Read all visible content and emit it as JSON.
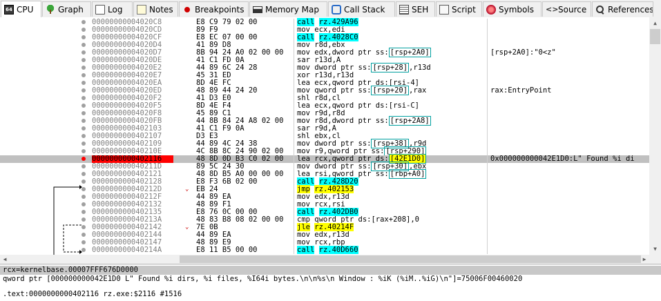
{
  "tabs": [
    {
      "label": "CPU",
      "icon": "cpu-icon"
    },
    {
      "label": "Graph",
      "icon": "tree-icon"
    },
    {
      "label": "Log",
      "icon": "log-icon"
    },
    {
      "label": "Notes",
      "icon": "notes-icon"
    },
    {
      "label": "Breakpoints",
      "icon": "breakpoint-icon"
    },
    {
      "label": "Memory Map",
      "icon": "memory-icon"
    },
    {
      "label": "Call Stack",
      "icon": "call-stack-icon"
    },
    {
      "label": "SEH",
      "icon": "seh-icon"
    },
    {
      "label": "Script",
      "icon": "script-icon"
    },
    {
      "label": "Symbols",
      "icon": "symbols-icon"
    },
    {
      "label": "Source",
      "icon": "source-icon"
    },
    {
      "label": "References",
      "icon": "search-icon"
    }
  ],
  "active_tab": "CPU",
  "rows": [
    {
      "addr": "00000000004020C8",
      "bytes": "E8 C9 79 02 00",
      "mn": "call",
      "op": "rz.429A96",
      "type": "call",
      "comment": ""
    },
    {
      "addr": "00000000004020CD",
      "bytes": "89 F9",
      "mn": "mov ecx,edi",
      "op": "",
      "type": "",
      "comment": ""
    },
    {
      "addr": "00000000004020CF",
      "bytes": "E8 EC 07 00 00",
      "mn": "call",
      "op": "rz.4028C0",
      "type": "call",
      "comment": ""
    },
    {
      "addr": "00000000004020D4",
      "bytes": "41 89 D8",
      "mn": "mov r8d,ebx",
      "op": "",
      "type": "",
      "comment": ""
    },
    {
      "addr": "00000000004020D7",
      "bytes": "8B 94 24 A0 02 00 00",
      "mn": "mov edx,dword ptr ss:",
      "op": "[rsp+2A0]",
      "type": "mem",
      "comment": "[rsp+2A0]:\"0<z\""
    },
    {
      "addr": "00000000004020DE",
      "bytes": "41 C1 FD 0A",
      "mn": "sar r13d,A",
      "op": "",
      "type": "",
      "comment": ""
    },
    {
      "addr": "00000000004020E2",
      "bytes": "44 89 6C 24 28",
      "mn": "mov dword ptr ss:",
      "op": "[rsp+28]",
      "tail": ",r13d",
      "type": "mem",
      "comment": ""
    },
    {
      "addr": "00000000004020E7",
      "bytes": "45 31 ED",
      "mn": "xor r13d,r13d",
      "op": "",
      "type": "",
      "comment": ""
    },
    {
      "addr": "00000000004020EA",
      "bytes": "8D 4E FC",
      "mn": "lea ecx,qword ptr ds:[rsi-4]",
      "op": "",
      "type": "",
      "comment": ""
    },
    {
      "addr": "00000000004020ED",
      "bytes": "48 89 44 24 20",
      "mn": "mov qword ptr ss:",
      "op": "[rsp+20]",
      "tail": ",rax",
      "type": "mem",
      "comment": "rax:EntryPoint"
    },
    {
      "addr": "00000000004020F2",
      "bytes": "41 D3 E0",
      "mn": "shl r8d,cl",
      "op": "",
      "type": "",
      "comment": ""
    },
    {
      "addr": "00000000004020F5",
      "bytes": "8D 4E F4",
      "mn": "lea ecx,qword ptr ds:[rsi-C]",
      "op": "",
      "type": "",
      "comment": ""
    },
    {
      "addr": "00000000004020F8",
      "bytes": "45 89 C1",
      "mn": "mov r9d,r8d",
      "op": "",
      "type": "",
      "comment": ""
    },
    {
      "addr": "00000000004020FB",
      "bytes": "44 8B 84 24 A8 02 00",
      "mn": "mov r8d,dword ptr ss:",
      "op": "[rsp+2A8]",
      "type": "mem",
      "comment": ""
    },
    {
      "addr": "0000000000402103",
      "bytes": "41 C1 F9 0A",
      "mn": "sar r9d,A",
      "op": "",
      "type": "",
      "comment": ""
    },
    {
      "addr": "0000000000402107",
      "bytes": "D3 E3",
      "mn": "shl ebx,cl",
      "op": "",
      "type": "",
      "comment": ""
    },
    {
      "addr": "0000000000402109",
      "bytes": "44 89 4C 24 38",
      "mn": "mov dword ptr ss:",
      "op": "[rsp+38]",
      "tail": ",r9d",
      "type": "mem",
      "comment": ""
    },
    {
      "addr": "000000000040210E",
      "bytes": "4C 8B 8C 24 90 02 00",
      "mn": "mov r9,qword ptr ss:",
      "op": "[rsp+290]",
      "type": "mem",
      "comment": ""
    },
    {
      "addr": "0000000000402116",
      "bytes": "48 8D 0D B3 C0 02 00",
      "mn": "lea rcx,qword ptr ds:",
      "op": "[42E1D0]",
      "type": "memy",
      "comment": "0x000000000042E1D0:L\" Found %i di",
      "selected": true
    },
    {
      "addr": "000000000040211D",
      "bytes": "89 5C 24 30",
      "mn": "mov dword ptr ss:",
      "op": "[rsp+30]",
      "tail": ",ebx",
      "type": "mem",
      "comment": ""
    },
    {
      "addr": "0000000000402121",
      "bytes": "48 8D B5 A0 00 00 00",
      "mn": "lea rsi,qword ptr ss:",
      "op": "[rbp+A0]",
      "type": "mem",
      "comment": ""
    },
    {
      "addr": "0000000000402128",
      "bytes": "E8 F3 6B 02 00",
      "mn": "call",
      "op": "rz.428D20",
      "type": "call",
      "comment": ""
    },
    {
      "addr": "000000000040212D",
      "bytes": "EB 24",
      "mn": "jmp",
      "op": "rz.402153",
      "type": "jmp",
      "comment": "",
      "arrow": true
    },
    {
      "addr": "000000000040212F",
      "bytes": "44 89 EA",
      "mn": "mov edx,r13d",
      "op": "",
      "type": "",
      "comment": ""
    },
    {
      "addr": "0000000000402132",
      "bytes": "48 89 F1",
      "mn": "mov rcx,rsi",
      "op": "",
      "type": "",
      "comment": ""
    },
    {
      "addr": "0000000000402135",
      "bytes": "E8 76 0C 00 00",
      "mn": "call",
      "op": "rz.402DB0",
      "type": "call",
      "comment": ""
    },
    {
      "addr": "000000000040213A",
      "bytes": "48 83 B8 08 02 00 00",
      "mn": "cmp qword ptr ds:[rax+208],0",
      "op": "",
      "type": "",
      "comment": ""
    },
    {
      "addr": "0000000000402142",
      "bytes": "7E 0B",
      "mn": "jle",
      "op": "rz.40214F",
      "type": "jmp",
      "comment": "",
      "arrow": true
    },
    {
      "addr": "0000000000402144",
      "bytes": "44 89 EA",
      "mn": "mov edx,r13d",
      "op": "",
      "type": "",
      "comment": ""
    },
    {
      "addr": "0000000000402147",
      "bytes": "48 89 E9",
      "mn": "mov rcx,rbp",
      "op": "",
      "type": "",
      "comment": ""
    },
    {
      "addr": "000000000040214A",
      "bytes": "E8 11 B5 00 00",
      "mn": "call",
      "op": "rz.40D660",
      "type": "call",
      "comment": ""
    }
  ],
  "info": {
    "line1": "rcx=kernelbase.00007FFF676D0000",
    "line2": "qword ptr [000000000042E1D0 L\" Found %i dirs, %i files, %I64i bytes.\\n\\n%s\\n Window : %iK (%iM..%iG)\\n\"]=75006F00460020",
    "line3": ".text:0000000000402116 rz.exe:$2116 #1516"
  },
  "colors": {
    "call_bg": "#00ffff",
    "jmp_bg": "#ffff00",
    "selected_row": "#c0c0c0",
    "breakpoint": "#ff0000"
  }
}
